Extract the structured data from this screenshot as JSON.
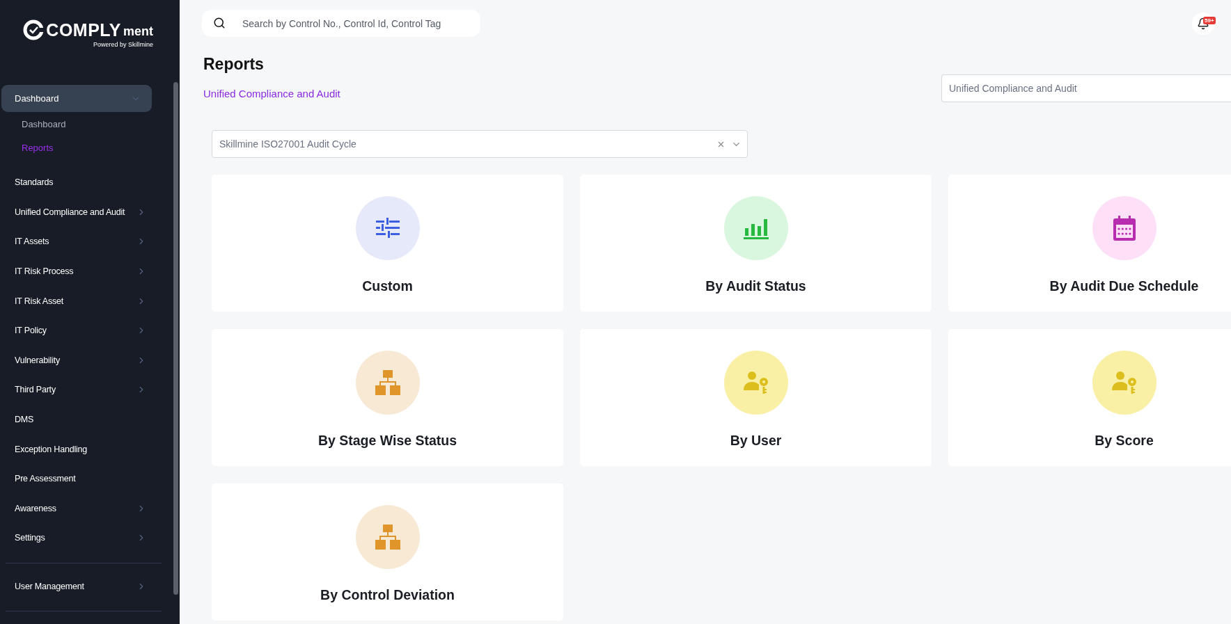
{
  "logo": {
    "name": "COMPLY",
    "suffix": "ment",
    "tagline": "Powered by Skillmine"
  },
  "sidebar": {
    "sections": [
      {
        "items": [
          {
            "label": "Dashboard",
            "kind": "group",
            "expanded": true,
            "children": [
              {
                "label": "Dashboard",
                "selected": false
              },
              {
                "label": "Reports",
                "selected": true
              }
            ]
          },
          {
            "label": "Standards",
            "kind": "link"
          },
          {
            "label": "Unified Compliance and Audit",
            "kind": "group",
            "expanded": false
          },
          {
            "label": "IT Assets",
            "kind": "group",
            "expanded": false
          },
          {
            "label": "IT Risk Process",
            "kind": "group",
            "expanded": false
          },
          {
            "label": "IT Risk Asset",
            "kind": "group",
            "expanded": false
          },
          {
            "label": "IT Policy",
            "kind": "group",
            "expanded": false
          },
          {
            "label": "Vulnerability",
            "kind": "group",
            "expanded": false
          },
          {
            "label": "Third Party",
            "kind": "group",
            "expanded": false
          },
          {
            "label": "DMS",
            "kind": "link"
          },
          {
            "label": "Exception Handling",
            "kind": "link"
          },
          {
            "label": "Pre Assessment",
            "kind": "link"
          },
          {
            "label": "Awareness",
            "kind": "group",
            "expanded": false
          },
          {
            "label": "Settings",
            "kind": "group",
            "expanded": false
          }
        ]
      },
      {
        "items": [
          {
            "label": "User Management",
            "kind": "group",
            "expanded": false
          }
        ]
      }
    ]
  },
  "search": {
    "placeholder": "Search by Control No., Control Id, Control Tag"
  },
  "notifications": {
    "badge": "59+"
  },
  "page": {
    "title": "Reports",
    "subtitle": "Unified Compliance and Audit",
    "module_field": {
      "value": "Unified Compliance and Audit"
    }
  },
  "cycle_select": {
    "value": "Skillmine ISO27001 Audit Cycle"
  },
  "cards": [
    {
      "title": "Custom",
      "kind": "filters"
    },
    {
      "title": "By Audit Status",
      "kind": "chart"
    },
    {
      "title": "By Audit Due Schedule",
      "kind": "calendar"
    },
    {
      "title": "By Stage Wise Status",
      "kind": "tree"
    },
    {
      "title": "By User",
      "kind": "person"
    },
    {
      "title": "By Score",
      "kind": "person"
    },
    {
      "title": "By Control Deviation",
      "kind": "tree"
    }
  ]
}
